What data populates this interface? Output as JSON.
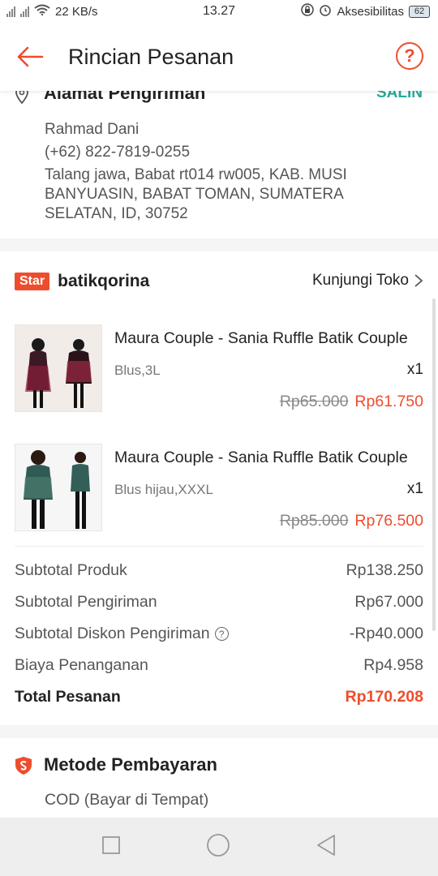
{
  "status_bar": {
    "net_speed": "22 KB/s",
    "time": "13.27",
    "accessibility": "Aksesibilitas",
    "battery": "62"
  },
  "header": {
    "title": "Rincian Pesanan",
    "help_glyph": "?"
  },
  "address": {
    "title": "Alamat Pengiriman",
    "copy_label": "SALIN",
    "name": "Rahmad Dani",
    "phone": "(+62) 822-7819-0255",
    "full_address": "Talang jawa, Babat rt014 rw005, KAB. MUSI BANYUASIN, BABAT TOMAN, SUMATERA SELATAN, ID, 30752"
  },
  "shop": {
    "badge": "Star",
    "name": "batikqorina",
    "visit_label": "Kunjungi Toko",
    "items": [
      {
        "name": "Maura Couple - Sania Ruffle Batik Couple",
        "variant": "Blus,3L",
        "qty": "x1",
        "original_price": "Rp65.000",
        "price": "Rp61.750"
      },
      {
        "name": "Maura Couple - Sania Ruffle Batik Couple",
        "variant": "Blus hijau,XXXL",
        "qty": "x1",
        "original_price": "Rp85.000",
        "price": "Rp76.500"
      }
    ]
  },
  "summary": {
    "rows": [
      {
        "label": "Subtotal Produk",
        "value": "Rp138.250"
      },
      {
        "label": "Subtotal Pengiriman",
        "value": "Rp67.000"
      },
      {
        "label": "Subtotal Diskon Pengiriman",
        "value": "-Rp40.000"
      },
      {
        "label": "Biaya Penanganan",
        "value": "Rp4.958"
      }
    ],
    "total_label": "Total Pesanan",
    "total_value": "Rp170.208"
  },
  "payment": {
    "title": "Metode Pembayaran",
    "method": "COD (Bayar di Tempat)"
  },
  "colors": {
    "accent": "#ee4d2d",
    "teal": "#26aa99"
  },
  "icons": [
    "back-arrow-icon",
    "help-icon",
    "location-pin-icon",
    "chevron-right-icon",
    "question-circle-icon",
    "payment-shield-icon",
    "recents-square-icon",
    "home-circle-icon",
    "back-triangle-icon"
  ]
}
